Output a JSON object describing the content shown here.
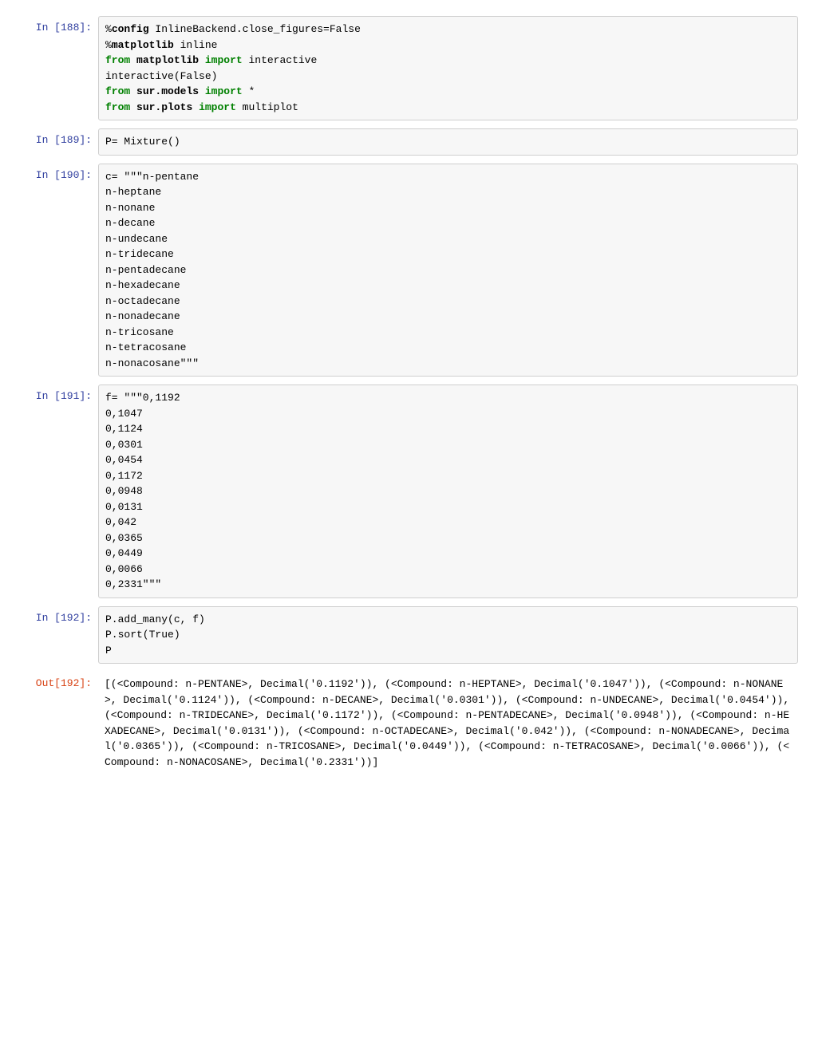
{
  "cells": [
    {
      "prompt": "In [188]:",
      "type": "code",
      "tokens": [
        {
          "t": "%",
          "c": ""
        },
        {
          "t": "config",
          "c": "hl-magic"
        },
        {
          "t": " InlineBackend.close_figures=False\n",
          "c": ""
        },
        {
          "t": "%",
          "c": ""
        },
        {
          "t": "matplotlib",
          "c": "hl-magic"
        },
        {
          "t": " inline\n",
          "c": ""
        },
        {
          "t": "from",
          "c": "hl-keyword"
        },
        {
          "t": " ",
          "c": ""
        },
        {
          "t": "matplotlib",
          "c": "hl-magic"
        },
        {
          "t": " ",
          "c": ""
        },
        {
          "t": "import",
          "c": "hl-keyword"
        },
        {
          "t": " interactive\n",
          "c": ""
        },
        {
          "t": "interactive(False)\n",
          "c": ""
        },
        {
          "t": "from",
          "c": "hl-keyword"
        },
        {
          "t": " ",
          "c": ""
        },
        {
          "t": "sur.models",
          "c": "hl-magic"
        },
        {
          "t": " ",
          "c": ""
        },
        {
          "t": "import",
          "c": "hl-keyword"
        },
        {
          "t": " *\n",
          "c": ""
        },
        {
          "t": "from",
          "c": "hl-keyword"
        },
        {
          "t": " ",
          "c": ""
        },
        {
          "t": "sur.plots",
          "c": "hl-magic"
        },
        {
          "t": " ",
          "c": ""
        },
        {
          "t": "import",
          "c": "hl-keyword"
        },
        {
          "t": " multiplot",
          "c": ""
        }
      ]
    },
    {
      "prompt": "In [189]:",
      "type": "code",
      "tokens": [
        {
          "t": "P= Mixture()",
          "c": ""
        }
      ]
    },
    {
      "prompt": "In [190]:",
      "type": "code",
      "tokens": [
        {
          "t": "c= \"\"\"n-pentane\nn-heptane\nn-nonane\nn-decane\nn-undecane\nn-tridecane\nn-pentadecane\nn-hexadecane\nn-octadecane\nn-nonadecane\nn-tricosane\nn-tetracosane\nn-nonacosane\"\"\"",
          "c": ""
        }
      ]
    },
    {
      "prompt": "In [191]:",
      "type": "code",
      "tokens": [
        {
          "t": "f= \"\"\"0,1192\n0,1047\n0,1124\n0,0301\n0,0454\n0,1172\n0,0948\n0,0131\n0,042\n0,0365\n0,0449\n0,0066\n0,2331\"\"\"",
          "c": ""
        }
      ]
    },
    {
      "prompt": "In [192]:",
      "type": "code",
      "tokens": [
        {
          "t": "P.add_many(c, f)\nP.sort(True)\nP",
          "c": ""
        }
      ]
    },
    {
      "prompt": "Out[192]:",
      "type": "output",
      "text": "[(<Compound: n-PENTANE>, Decimal('0.1192')), (<Compound: n-HEPTANE>, Decimal('0.1047')), (<Compound: n-NONANE>, Decimal('0.1124')), (<Compound: n-DECANE>, Decimal('0.0301')), (<Compound: n-UNDECANE>, Decimal('0.0454')), (<Compound: n-TRIDECANE>, Decimal('0.1172')), (<Compound: n-PENTADECANE>, Decimal('0.0948')), (<Compound: n-HEXADECANE>, Decimal('0.0131')), (<Compound: n-OCTADECANE>, Decimal('0.042')), (<Compound: n-NONADECANE>, Decimal('0.0365')), (<Compound: n-TRICOSANE>, Decimal('0.0449')), (<Compound: n-TETRACOSANE>, Decimal('0.0066')), (<Compound: n-NONACOSANE>, Decimal('0.2331'))]"
    }
  ]
}
